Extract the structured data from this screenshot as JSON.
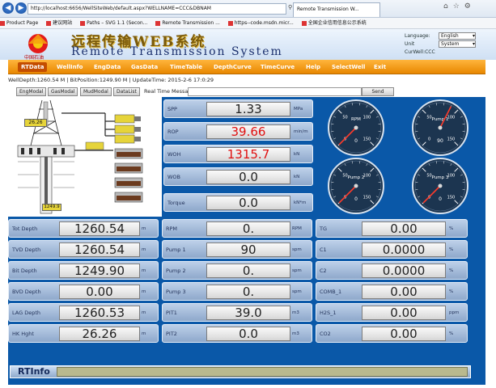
{
  "browser": {
    "url": "http://localhost:6656/WellSiteWeb/default.aspx?WELLNAME=CCC&DBNAM",
    "url_icons": "⚲ ▾ ☒ ↻ ✕",
    "active_tab": "Remote Transmission W...",
    "favorites": [
      "Product Page",
      "建议网站",
      "Paths – SVG 1.1 (Secon...",
      "Remote Transmission ...",
      "https--code.msdn.micr...",
      "全国企业信用信息公示系统"
    ]
  },
  "header": {
    "title_cn": "远程传输WEB系统",
    "title_en": "Remote Transmission System",
    "logo_text": "中国石油",
    "language_label": "Language:",
    "language_value": "English",
    "unit_label": "Unit",
    "unit_value": "System",
    "curwell_label": "CurWell:CCC"
  },
  "menu": [
    "RTData",
    "WellInfo",
    "EngData",
    "GasData",
    "TimeTable",
    "DepthCurve",
    "TimeCurve",
    "Help",
    "SelectWell",
    "Exit"
  ],
  "status_line": "WellDepth:1260.54 M | BitPosition:1249.90 M | UpdateTime: 2015-2-6 17:0:29",
  "toolbar": {
    "buttons": [
      "EngModal",
      "GasModal",
      "MudModal",
      "DataList"
    ],
    "message_label": "Real Time Message:",
    "send_label": "Send"
  },
  "schematic": {
    "hook_height": "26.26",
    "bit_depth": "1249.9"
  },
  "drilling": [
    {
      "label": "SPP",
      "value": "1.33",
      "unit": "MPa",
      "color": "#222222"
    },
    {
      "label": "ROP",
      "value": "39.66",
      "unit": "min/m",
      "color": "#e01010"
    },
    {
      "label": "WOH",
      "value": "1315.7",
      "unit": "kN",
      "color": "#e01010"
    },
    {
      "label": "WOB",
      "value": "0.0",
      "unit": "kN",
      "color": "#222222"
    },
    {
      "label": "Torque",
      "value": "0.0",
      "unit": "kN*m",
      "color": "#222222"
    }
  ],
  "gauges": [
    {
      "name": "RPM",
      "max": "150",
      "mid": "100",
      "low": "50",
      "zero": "0",
      "reading": "0"
    },
    {
      "name": "Pump 1",
      "max": "150",
      "mid": "100",
      "low": "50",
      "zero": "0",
      "reading": "90"
    },
    {
      "name": "Pump 2",
      "max": "150",
      "mid": "100",
      "low": "50",
      "zero": "0",
      "reading": "0"
    },
    {
      "name": "Pump 3",
      "max": "150",
      "mid": "100",
      "low": "50",
      "zero": "0",
      "reading": "0"
    }
  ],
  "depth_rows": [
    {
      "label": "Tot Depth",
      "value": "1260.54",
      "unit": "m"
    },
    {
      "label": "TVD Depth",
      "value": "1260.54",
      "unit": "m"
    },
    {
      "label": "Bit Depth",
      "value": "1249.90",
      "unit": "m"
    },
    {
      "label": "BVD Depth",
      "value": "0.00",
      "unit": "m"
    },
    {
      "label": "LAG Depth",
      "value": "1260.53",
      "unit": "m"
    },
    {
      "label": "HK Hght",
      "value": "26.26",
      "unit": "m"
    }
  ],
  "pump_rows": [
    {
      "label": "RPM",
      "value": "0.",
      "unit": "RPM"
    },
    {
      "label": "Pump 1",
      "value": "90",
      "unit": "spm"
    },
    {
      "label": "Pump 2",
      "value": "0.",
      "unit": "spm"
    },
    {
      "label": "Pump 3",
      "value": "0.",
      "unit": "spm"
    },
    {
      "label": "PIT1",
      "value": "39.0",
      "unit": "m3"
    },
    {
      "label": "PIT2",
      "value": "0.0",
      "unit": "m3"
    }
  ],
  "gas_rows": [
    {
      "label": "TG",
      "value": "0.00",
      "unit": "%"
    },
    {
      "label": "C1",
      "value": "0.0000",
      "unit": "%"
    },
    {
      "label": "C2",
      "value": "0.0000",
      "unit": "%"
    },
    {
      "label": "COMB_1",
      "value": "0.00",
      "unit": "%"
    },
    {
      "label": "H2S_1",
      "value": "0.00",
      "unit": "ppm"
    },
    {
      "label": "CO2",
      "value": "0.00",
      "unit": "%"
    }
  ],
  "rt_info": {
    "label": "RTInfo"
  },
  "colors": {
    "panel_bg": "#0a58a8",
    "menu_orange": "#f39a1a",
    "alert_red": "#e01010"
  }
}
